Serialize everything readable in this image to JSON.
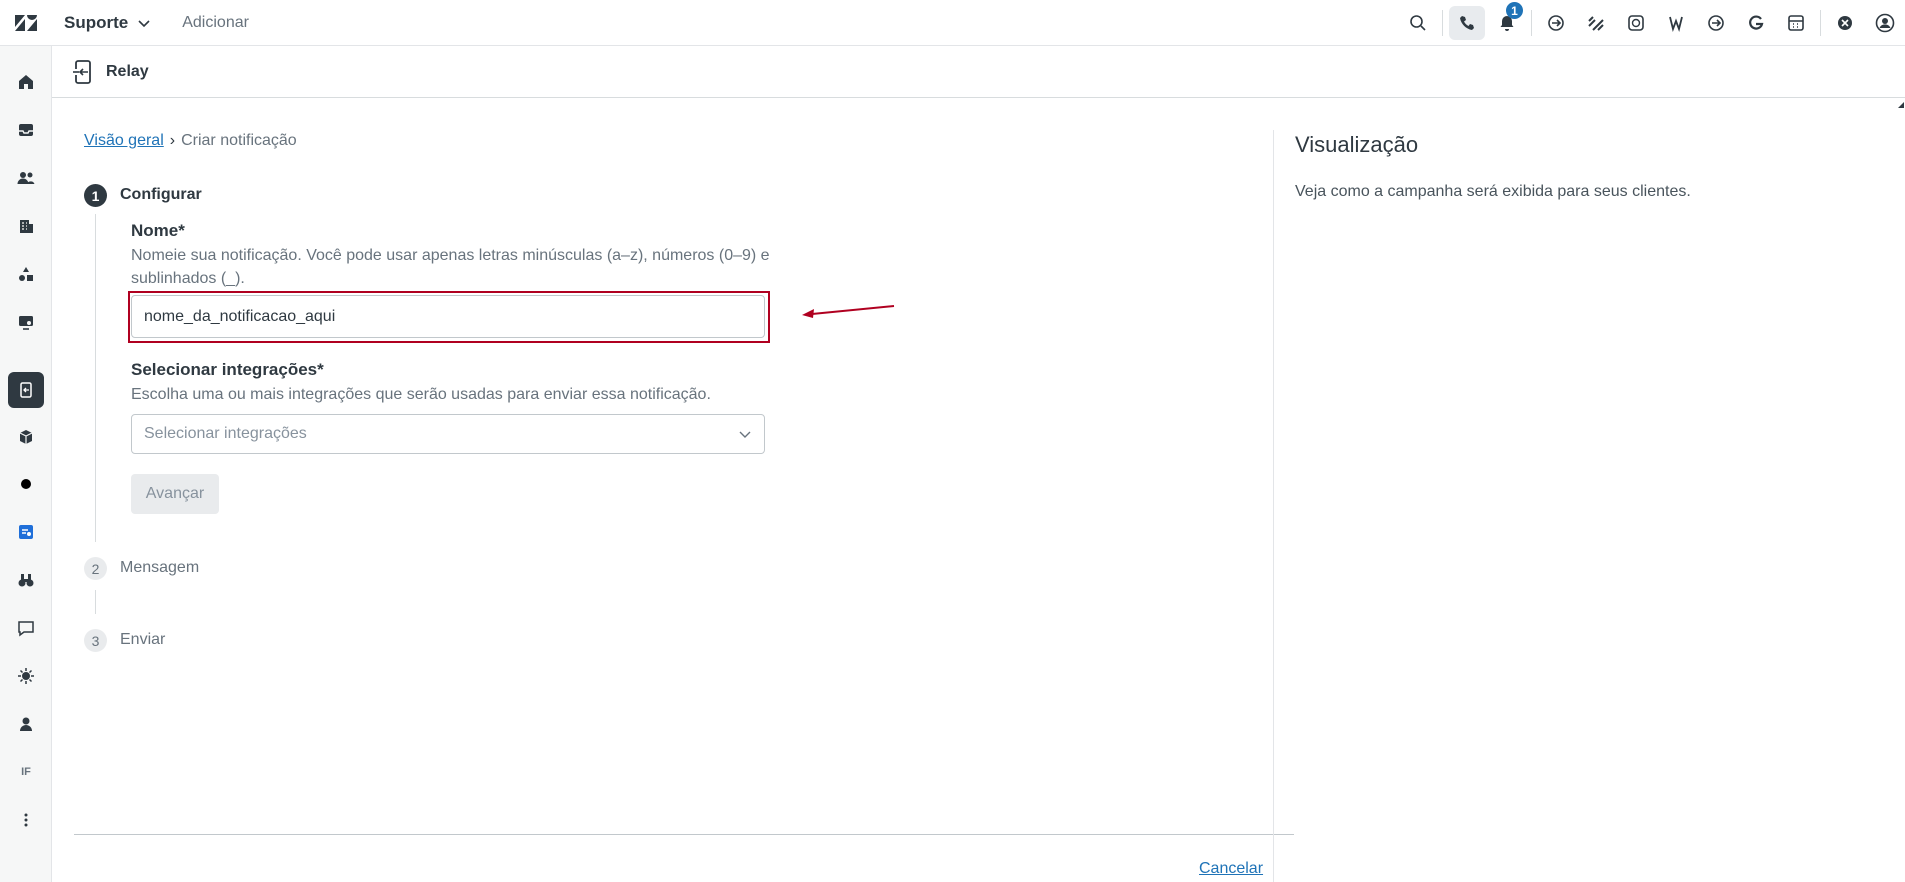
{
  "topbar": {
    "product_name": "Suporte",
    "add_label": "Adicionar",
    "notification_count": "1"
  },
  "app": {
    "title": "Relay"
  },
  "breadcrumb": {
    "parent": "Visão geral",
    "separator": "›",
    "current": "Criar notificação"
  },
  "steps": [
    {
      "number": "1",
      "label": "Configurar"
    },
    {
      "number": "2",
      "label": "Mensagem"
    },
    {
      "number": "3",
      "label": "Enviar"
    }
  ],
  "form": {
    "name_label": "Nome*",
    "name_hint": "Nomeie sua notificação. Você pode usar apenas letras minúsculas (a–z), números (0–9) e sublinhados (_).",
    "name_value": "nome_da_notificacao_aqui",
    "integrations_label": "Selecionar integrações*",
    "integrations_hint": "Escolha uma ou mais integrações que serão usadas para enviar essa notificação.",
    "integrations_placeholder": "Selecionar integrações",
    "advance_label": "Avançar",
    "cancel_label": "Cancelar"
  },
  "preview": {
    "title": "Visualização",
    "description": "Veja como a campanha será exibida para seus clientes."
  },
  "rail": {
    "text_item": "IF"
  },
  "colors": {
    "accent": "#1f73b7",
    "highlight": "#b00020",
    "rail_active": "#2f3941"
  }
}
